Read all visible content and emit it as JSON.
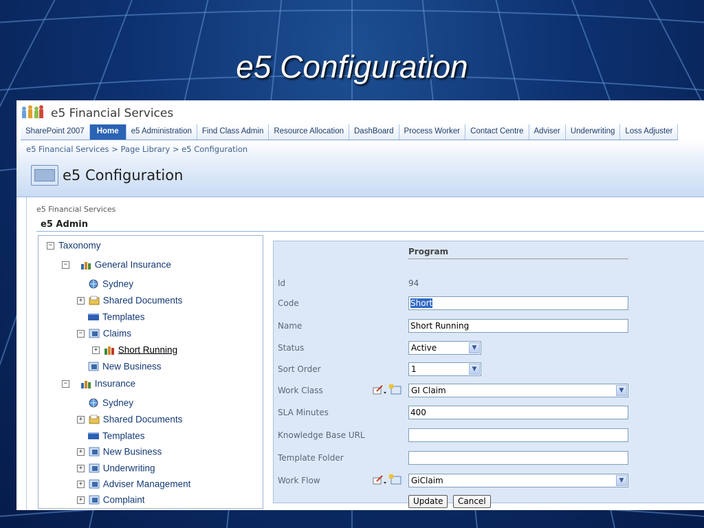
{
  "slide": {
    "title": "e5 Configuration"
  },
  "site": {
    "name": "e5 Financial Services"
  },
  "tabs": [
    {
      "label": "SharePoint 2007",
      "active": false
    },
    {
      "label": "Home",
      "active": true
    },
    {
      "label": "e5 Administration",
      "active": false
    },
    {
      "label": "Find Class Admin",
      "active": false
    },
    {
      "label": "Resource Allocation",
      "active": false
    },
    {
      "label": "DashBoard",
      "active": false
    },
    {
      "label": "Process Worker",
      "active": false
    },
    {
      "label": "Contact Centre",
      "active": false
    },
    {
      "label": "Adviser",
      "active": false
    },
    {
      "label": "Underwriting",
      "active": false
    },
    {
      "label": "Loss Adjuster",
      "active": false
    }
  ],
  "breadcrumb": "e5 Financial Services > Page Library > e5 Configuration",
  "page_title": "e5 Configuration",
  "content": {
    "crumb": "e5 Financial Services",
    "heading": "e5 Admin"
  },
  "tree": [
    {
      "label": "Taxonomy",
      "toggle": "−",
      "icon": "none"
    },
    {
      "label": "General Insurance",
      "toggle": "−",
      "icon": "people-icon"
    },
    {
      "label": "Sydney",
      "toggle": "",
      "icon": "globe-icon"
    },
    {
      "label": "Shared Documents",
      "toggle": "+",
      "icon": "folder-icon"
    },
    {
      "label": "Templates",
      "toggle": "",
      "icon": "template-icon"
    },
    {
      "label": "Claims",
      "toggle": "−",
      "icon": "list-icon"
    },
    {
      "label": "Short Running",
      "toggle": "+",
      "icon": "people-icon",
      "selected": true
    },
    {
      "label": "New Business",
      "toggle": "",
      "icon": "list-icon"
    },
    {
      "label": "Insurance",
      "toggle": "−",
      "icon": "people-icon"
    },
    {
      "label": "Sydney",
      "toggle": "",
      "icon": "globe-icon"
    },
    {
      "label": "Shared Documents",
      "toggle": "+",
      "icon": "folder-icon"
    },
    {
      "label": "Templates",
      "toggle": "",
      "icon": "template-icon"
    },
    {
      "label": "New Business",
      "toggle": "+",
      "icon": "list-icon"
    },
    {
      "label": "Underwriting",
      "toggle": "+",
      "icon": "list-icon"
    },
    {
      "label": "Adviser Management",
      "toggle": "+",
      "icon": "list-icon"
    },
    {
      "label": "Complaint",
      "toggle": "+",
      "icon": "list-icon"
    }
  ],
  "form": {
    "header": "Program",
    "fields": {
      "id": {
        "label": "Id",
        "value": "94"
      },
      "code": {
        "label": "Code",
        "value": "Short"
      },
      "name": {
        "label": "Name",
        "value": "Short Running"
      },
      "status": {
        "label": "Status",
        "value": "Active"
      },
      "sort_order": {
        "label": "Sort Order",
        "value": "1"
      },
      "work_class": {
        "label": "Work Class",
        "value": "GI Claim"
      },
      "sla_minutes": {
        "label": "SLA Minutes",
        "value": "400"
      },
      "kb_url": {
        "label": "Knowledge Base URL",
        "value": ""
      },
      "template_folder": {
        "label": "Template Folder",
        "value": ""
      },
      "work_flow": {
        "label": "Work Flow",
        "value": "GiClaim"
      }
    },
    "update_label": "Update",
    "cancel_label": "Cancel"
  }
}
